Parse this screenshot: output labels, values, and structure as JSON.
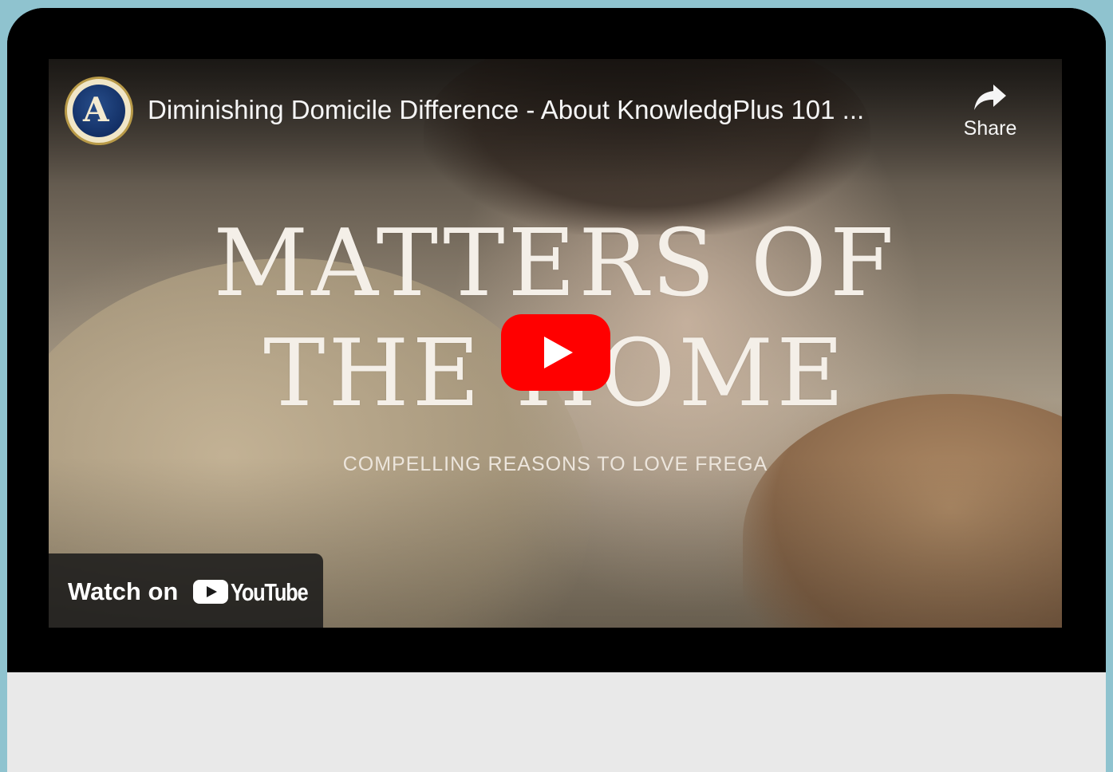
{
  "video": {
    "title": "Diminishing Domicile Difference - About KnowledgPlus 101 ...",
    "channel_avatar_icon": "channel-logo-icon",
    "share_label": "Share",
    "thumbnail": {
      "headline_line1": "MATTERS OF",
      "headline_line2": "THE HOME",
      "subheadline": "COMPELLING  REASONS TO  LOVE FREGA"
    },
    "watch_on_label": "Watch on",
    "youtube_wordmark": "YouTube"
  },
  "colors": {
    "page_background": "#8fc3cf",
    "player_frame": "#000000",
    "play_button_red": "#ff0000",
    "below_panel": "#e9e9e9"
  }
}
